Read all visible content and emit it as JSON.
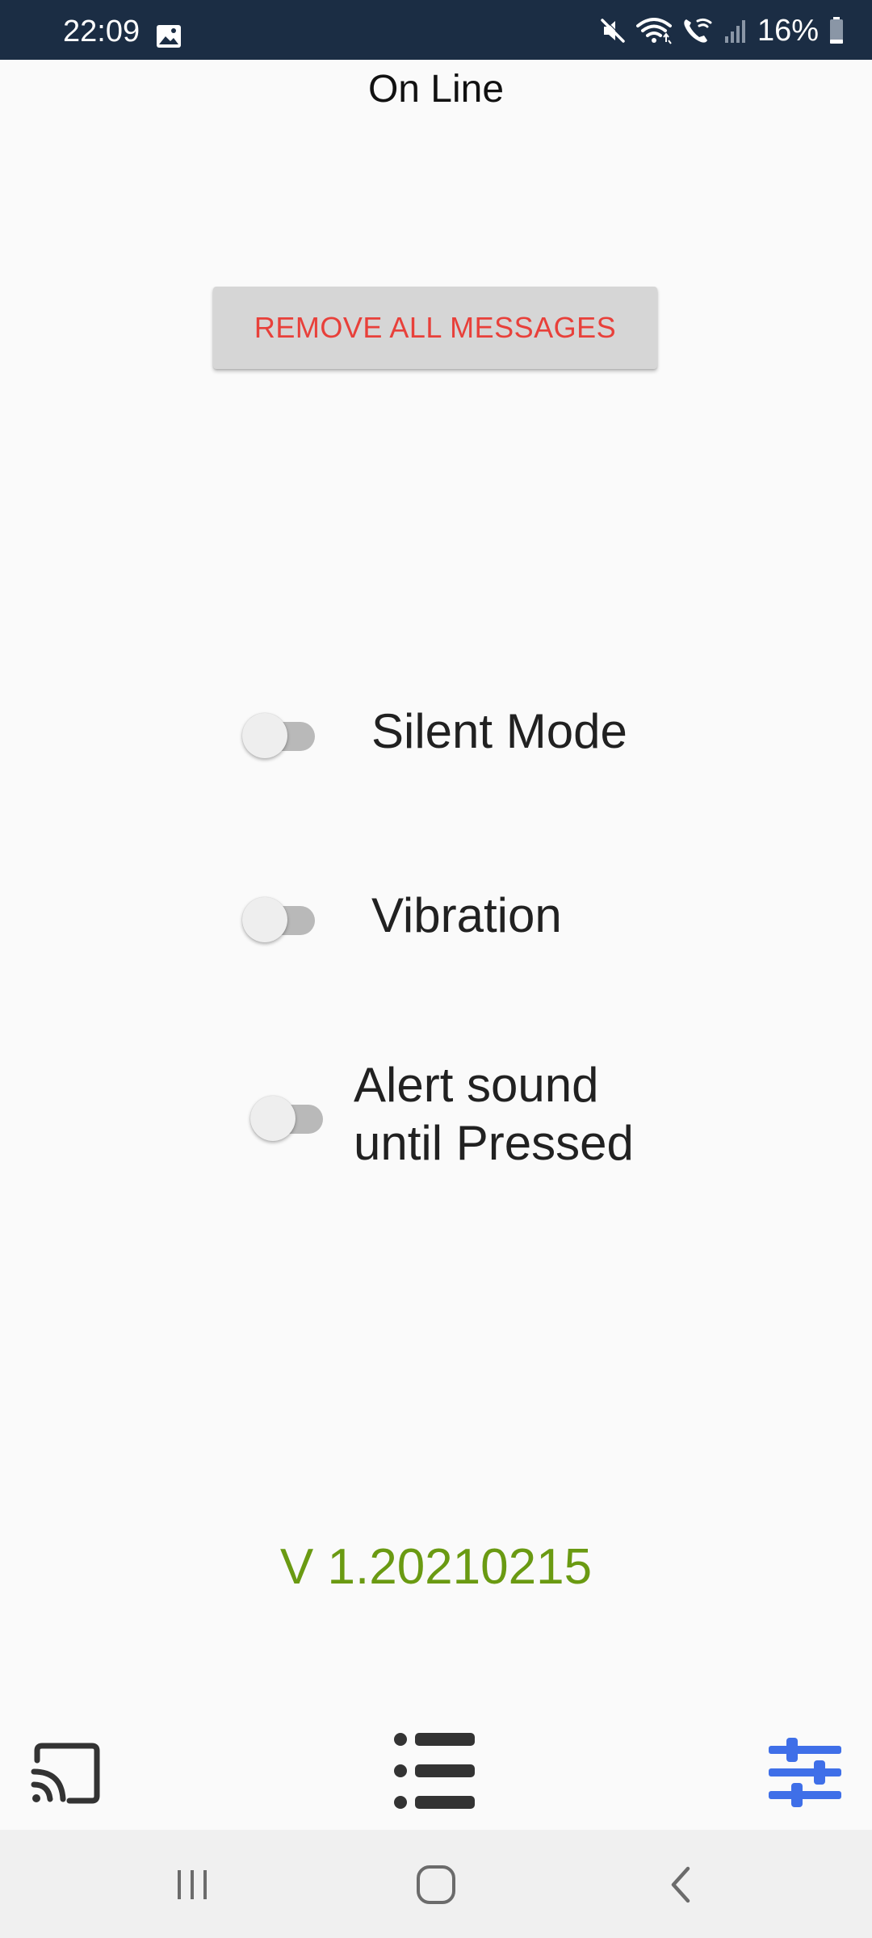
{
  "status_bar": {
    "time": "22:09",
    "battery": "16%",
    "icons": [
      "gallery-icon",
      "mute-icon",
      "wifi-icon",
      "wifi-calling-icon",
      "signal-icon",
      "battery-icon"
    ],
    "background_color": "#1b2d44"
  },
  "header": {
    "title": "On Line"
  },
  "actions": {
    "remove_all_label": "REMOVE ALL MESSAGES",
    "label_color": "#e8403a"
  },
  "settings": [
    {
      "label": "Silent Mode",
      "enabled": false
    },
    {
      "label": "Vibration",
      "enabled": false
    },
    {
      "label": "Alert sound\nuntil Pressed",
      "enabled": false
    }
  ],
  "footer": {
    "version": "V 1.20210215",
    "version_color": "#6a9a12"
  },
  "toolbar": {
    "items": [
      {
        "icon": "cast-icon",
        "active": false
      },
      {
        "icon": "list-icon",
        "active": false
      },
      {
        "icon": "tune-icon",
        "active": true
      }
    ],
    "active_color": "#3f6fe8"
  },
  "nav_bar": {
    "buttons": [
      "recents-icon",
      "home-icon",
      "back-icon"
    ]
  }
}
